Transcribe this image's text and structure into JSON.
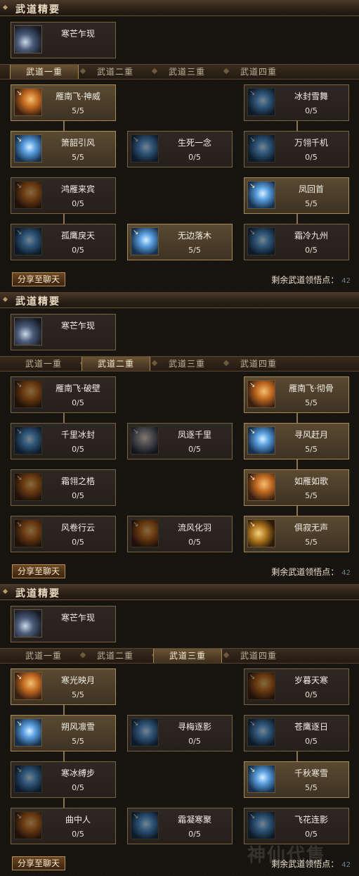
{
  "panels": [
    {
      "header": "武道精要",
      "top_skill": {
        "name": "寒芒乍现"
      },
      "tabs": [
        "武道一重",
        "武道二重",
        "武道三重",
        "武道四重"
      ],
      "selected_tab": 0,
      "skills": [
        {
          "name": "雁南飞·神威",
          "points": "5/5",
          "active": true,
          "col": 0,
          "row": 0,
          "hue": "orange"
        },
        {
          "name": "冰封雪舞",
          "points": "0/5",
          "active": false,
          "col": 2,
          "row": 0,
          "hue": "blue"
        },
        {
          "name": "箫韶引风",
          "points": "5/5",
          "active": true,
          "col": 0,
          "row": 1,
          "hue": "blue"
        },
        {
          "name": "生死一念",
          "points": "0/5",
          "active": false,
          "col": 1,
          "row": 1,
          "hue": "blue"
        },
        {
          "name": "万翎千机",
          "points": "0/5",
          "active": false,
          "col": 2,
          "row": 1,
          "hue": "blue"
        },
        {
          "name": "鸿雁来宾",
          "points": "0/5",
          "active": false,
          "col": 0,
          "row": 2,
          "hue": "orange"
        },
        {
          "name": "凤回首",
          "points": "5/5",
          "active": true,
          "col": 2,
          "row": 2,
          "hue": "blue"
        },
        {
          "name": "孤鹰戾天",
          "points": "0/5",
          "active": false,
          "col": 0,
          "row": 3,
          "hue": "blue"
        },
        {
          "name": "无边落木",
          "points": "5/5",
          "active": true,
          "col": 1,
          "row": 3,
          "hue": "blue"
        },
        {
          "name": "霜冷九州",
          "points": "0/5",
          "active": false,
          "col": 2,
          "row": 3,
          "hue": "blue"
        }
      ],
      "connectors": [
        [
          0,
          0
        ],
        [
          0,
          2
        ],
        [
          2,
          0
        ],
        [
          2,
          2
        ]
      ],
      "share_label": "分享至聊天",
      "remaining_label": "剩余武道领悟点：",
      "remaining_value": "42"
    },
    {
      "header": "武道精要",
      "top_skill": {
        "name": "寒芒乍现"
      },
      "tabs": [
        "武道一重",
        "武道二重",
        "武道三重",
        "武道四重"
      ],
      "selected_tab": 1,
      "skills": [
        {
          "name": "雁南飞·破壁",
          "points": "0/5",
          "active": false,
          "col": 0,
          "row": 0,
          "hue": "orange"
        },
        {
          "name": "雁南飞·彻骨",
          "points": "5/5",
          "active": true,
          "col": 2,
          "row": 0,
          "hue": "orange"
        },
        {
          "name": "千里冰封",
          "points": "0/5",
          "active": false,
          "col": 0,
          "row": 1,
          "hue": "blue"
        },
        {
          "name": "凤逐千里",
          "points": "0/5",
          "active": false,
          "col": 1,
          "row": 1,
          "hue": "face"
        },
        {
          "name": "寻风赶月",
          "points": "5/5",
          "active": true,
          "col": 2,
          "row": 1,
          "hue": "blue"
        },
        {
          "name": "霜翎之梏",
          "points": "0/5",
          "active": false,
          "col": 0,
          "row": 2,
          "hue": "orange"
        },
        {
          "name": "如雁如歌",
          "points": "5/5",
          "active": true,
          "col": 2,
          "row": 2,
          "hue": "orange"
        },
        {
          "name": "风卷行云",
          "points": "0/5",
          "active": false,
          "col": 0,
          "row": 3,
          "hue": "orange"
        },
        {
          "name": "流风化羽",
          "points": "0/5",
          "active": false,
          "col": 1,
          "row": 3,
          "hue": "orange"
        },
        {
          "name": "俱寂无声",
          "points": "5/5",
          "active": true,
          "col": 2,
          "row": 3,
          "hue": "gold"
        }
      ],
      "connectors": [
        [
          0,
          0
        ],
        [
          2,
          0
        ],
        [
          2,
          1
        ],
        [
          2,
          2
        ]
      ],
      "share_label": "分享至聊天",
      "remaining_label": "剩余武道领悟点：",
      "remaining_value": "42"
    },
    {
      "header": "武道精要",
      "top_skill": {
        "name": "寒芒乍现"
      },
      "tabs": [
        "武道一重",
        "武道二重",
        "武道三重",
        "武道四重"
      ],
      "selected_tab": 2,
      "skills": [
        {
          "name": "寒光映月",
          "points": "5/5",
          "active": true,
          "col": 0,
          "row": 0,
          "hue": "orange"
        },
        {
          "name": "岁暮天寒",
          "points": "0/5",
          "active": false,
          "col": 2,
          "row": 0,
          "hue": "orange"
        },
        {
          "name": "朔风凛雪",
          "points": "5/5",
          "active": true,
          "col": 0,
          "row": 1,
          "hue": "blue"
        },
        {
          "name": "寻梅逐影",
          "points": "0/5",
          "active": false,
          "col": 1,
          "row": 1,
          "hue": "blue"
        },
        {
          "name": "苍鹰逐日",
          "points": "0/5",
          "active": false,
          "col": 2,
          "row": 1,
          "hue": "blue"
        },
        {
          "name": "寒冰缚步",
          "points": "0/5",
          "active": false,
          "col": 0,
          "row": 2,
          "hue": "blue"
        },
        {
          "name": "千秋寒雪",
          "points": "5/5",
          "active": true,
          "col": 2,
          "row": 2,
          "hue": "blue"
        },
        {
          "name": "曲中人",
          "points": "0/5",
          "active": false,
          "col": 0,
          "row": 3,
          "hue": "orange"
        },
        {
          "name": "霜凝寒聚",
          "points": "0/5",
          "active": false,
          "col": 1,
          "row": 3,
          "hue": "blue"
        },
        {
          "name": "飞花连影",
          "points": "0/5",
          "active": false,
          "col": 2,
          "row": 3,
          "hue": "blue"
        }
      ],
      "connectors": [
        [
          0,
          0
        ],
        [
          0,
          1
        ],
        [
          0,
          2
        ],
        [
          2,
          1
        ]
      ],
      "share_label": "分享至聊天",
      "remaining_label": "剩余武道领悟点：",
      "remaining_value": "42"
    }
  ],
  "watermark": "神仙代售",
  "colors": {
    "active_box": "#5a4a33",
    "inactive_box": "#2a2420",
    "accent": "#b68f4f"
  }
}
